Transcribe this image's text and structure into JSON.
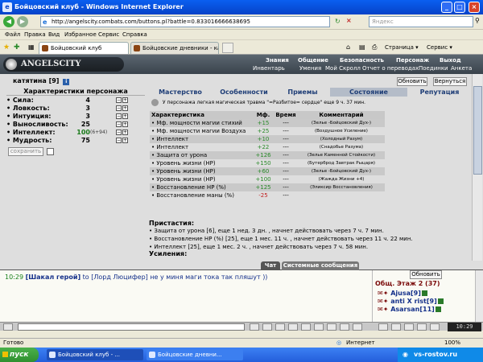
{
  "window": {
    "title": "Бойцовский клуб - Windows Internet Explorer"
  },
  "address": {
    "url": "http://angelscity.combats.com/buttons.pl?battle=0.833016666638695",
    "search_placeholder": "Яндекс"
  },
  "menu": [
    "Файл",
    "Правка",
    "Вид",
    "Избранное",
    "Сервис",
    "Справка"
  ],
  "tabs": [
    {
      "label": "Бойцовский клуб"
    },
    {
      "label": "Бойцовские дневники - катя..."
    }
  ],
  "toolbar": {
    "page_label": "Страница",
    "service_label": "Сервис"
  },
  "game": {
    "logo": "ANGELSCITY",
    "nav_top": [
      "Знания",
      "Общение",
      "Безопасность",
      "Персонаж",
      "Выход"
    ],
    "nav_bottom": [
      "Инвентарь",
      "Умения",
      "Мой Скролл",
      "Отчет о переводах",
      "Поединки",
      "Анкета"
    ]
  },
  "character": {
    "name": "катятина",
    "level": "[9]"
  },
  "buttons": {
    "refresh": "Обновить",
    "back": "Вернуться",
    "save": "сохранить"
  },
  "left_panel": {
    "header": "Характеристики персонажа",
    "stats": [
      {
        "name": "• Сила:",
        "value": "4",
        "bonus": ""
      },
      {
        "name": "• Ловкость:",
        "value": "3",
        "bonus": ""
      },
      {
        "name": "• Интуиция:",
        "value": "3",
        "bonus": ""
      },
      {
        "name": "• Выносливость:",
        "value": "25",
        "bonus": ""
      },
      {
        "name": "• Интеллект:",
        "value": "100",
        "bonus": "(6+94)"
      },
      {
        "name": "• Мудрость:",
        "value": "75",
        "bonus": ""
      }
    ]
  },
  "right_tabs": [
    "Мастерство",
    "Особенности",
    "Приемы",
    "Состояние",
    "Репутация"
  ],
  "injury_text": "У персонажа легкая магическая травма \"=Разбитое= сердце\" еще 9 ч. 37 мин.",
  "effects_table": {
    "headers": [
      "Характеристика",
      "Мф.",
      "Время",
      "Комментарий"
    ],
    "rows": [
      {
        "name": "• Мф. мощности магии стихий",
        "mf": "+15",
        "time": "---",
        "comment": "(Зелье -Бойцовский Дух-)"
      },
      {
        "name": "• Мф. мощности магии Воздуха",
        "mf": "+25",
        "time": "---",
        "comment": "(Воздушное Усиление)"
      },
      {
        "name": "• Интеллект",
        "mf": "+10",
        "time": "---",
        "comment": "(Холодный Разум)"
      },
      {
        "name": "• Интеллект",
        "mf": "+22",
        "time": "---",
        "comment": "(Снадобье Разума)"
      },
      {
        "name": "• Защита от урона",
        "mf": "+126",
        "time": "---",
        "comment": "(Зелье Каменной Стойкости)"
      },
      {
        "name": "• Уровень жизни (HP)",
        "mf": "+150",
        "time": "---",
        "comment": "(Бутерброд Завтрак Рыцаря)"
      },
      {
        "name": "• Уровень жизни (HP)",
        "mf": "+60",
        "time": "---",
        "comment": "(Зелье -Бойцовский Дух-)"
      },
      {
        "name": "• Уровень жизни (HP)",
        "mf": "+100",
        "time": "---",
        "comment": "(Жажда Жизни +4)"
      },
      {
        "name": "• Восстановление HP (%)",
        "mf": "+125",
        "time": "---",
        "comment": "(Эликсир Восстановления)"
      },
      {
        "name": "• Восстановление маны (%)",
        "mf": "-25",
        "time": "---",
        "comment": ""
      }
    ]
  },
  "enhancements": {
    "header": "Пристастия:",
    "rows": [
      "• Защита от урона [6], еще 1 нед. 3 дн. , начнет действовать через 7 ч. 7 мин.",
      "• Восстановление HP (%) [25], еще 1 мес. 11 ч. , начнет действовать через 11 ч. 22 мин.",
      "• Интеллект [25], еще 1 мес. 2 ч. , начнет действовать через 7 ч. 58 мин."
    ],
    "next_header": "Усиления:"
  },
  "chat": {
    "tabs": [
      "Чат",
      "Системные сообщения"
    ],
    "line": {
      "time": "10:29",
      "name": "[Шакал герой]",
      "to_word": "to",
      "recipient": "[Лорд Люцифер]",
      "message": "не у миня маги тока так пляшут ))"
    }
  },
  "online": {
    "refresh": "Обновить",
    "title": "Общ. Этаж 2 (37)",
    "users": [
      {
        "name": "Ajusa",
        "level": "[9]"
      },
      {
        "name": "anti X rist",
        "level": "[9]"
      },
      {
        "name": "Asarsan",
        "level": "[11]"
      }
    ]
  },
  "clock": "10:29",
  "statusbar": {
    "left": "Готово",
    "zone": "Интернет",
    "zoom": "100%"
  },
  "taskbar": {
    "start": "пуск",
    "tasks": [
      "Бойцовский клуб - ...",
      "Бойцовские дневни..."
    ],
    "watermark": "vs-rostov.ru"
  }
}
